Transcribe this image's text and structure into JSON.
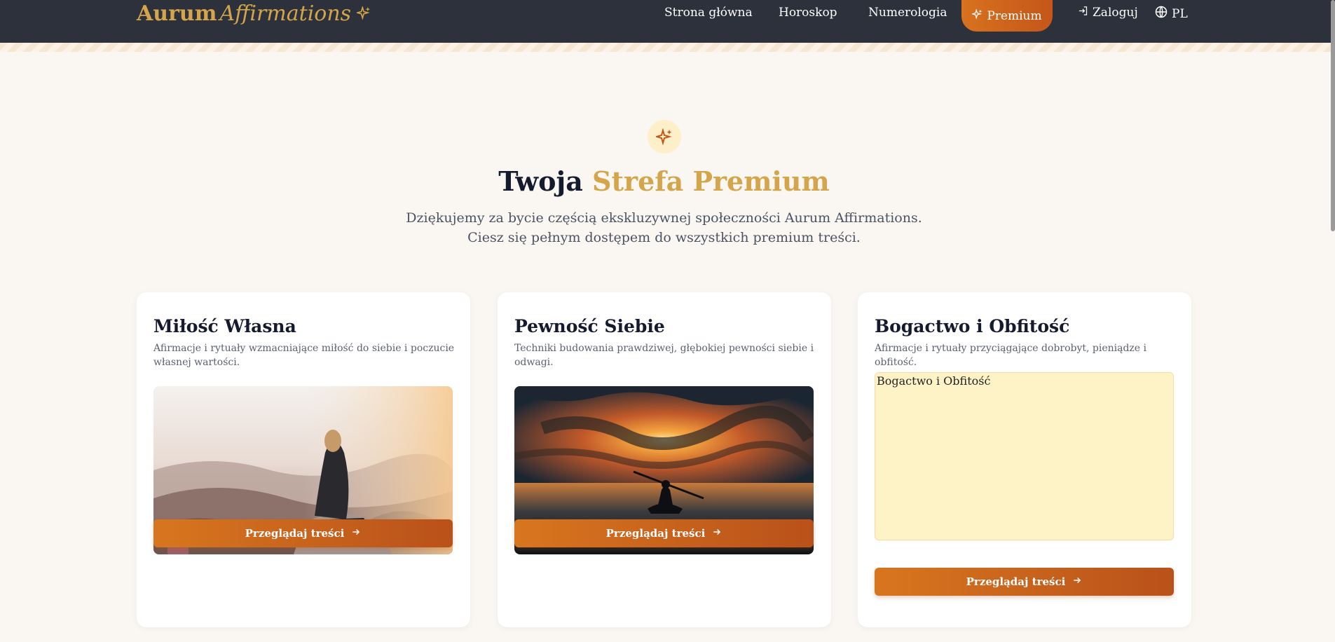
{
  "nav": {
    "logo_bold": "Aurum",
    "logo_italic": "Affirmations",
    "logo_icon": "sparkles-icon",
    "links": [
      "Strona główna",
      "Horoskop",
      "Numerologia"
    ],
    "premium_label": "Premium",
    "login_label": "Zaloguj",
    "language_label": "PL"
  },
  "hero": {
    "icon": "sparkles-icon",
    "title_plain": "Twoja",
    "title_accent": "Strefa Premium",
    "subtitle_line1": "Dziękujemy za bycie częścią ekskluzywnej społeczności Aurum Affirmations.",
    "subtitle_line2": "Ciesz się pełnym dostępem do wszystkich premium treści."
  },
  "cards": [
    {
      "title": "Miłość Własna",
      "description": "Afirmacje i rytuały wzmacniające miłość do siebie i poczucie własnej wartości.",
      "image": "woman-on-mountain-photo",
      "button_label": "Przeglądaj treści"
    },
    {
      "title": "Pewność Siebie",
      "description": "Techniki budowania prawdziwej, głębokiej pewności siebie i odwagi.",
      "image": "kayak-sunset-photo",
      "button_label": "Przeglądaj treści"
    },
    {
      "title": "Bogactwo i Obfitość",
      "description": "Afirmacje i rytuały przyciągające dobrobyt, pieniądze i obfitość.",
      "image_alt": "Bogactwo i Obfitość",
      "button_label": "Przeglądaj treści"
    }
  ],
  "colors": {
    "nav_bg": "#2c313c",
    "gold": "#d4a54a",
    "orange": "#d8721e",
    "page_bg": "#faf7f2"
  }
}
